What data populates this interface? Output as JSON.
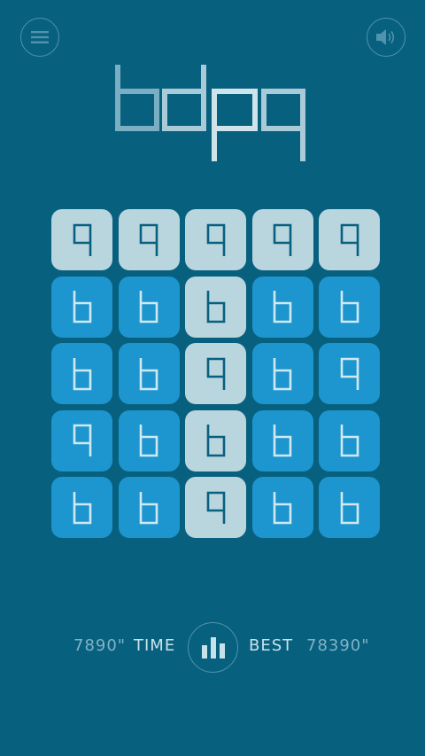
{
  "logo_text": "bdpq",
  "icons": {
    "menu": "menu-icon",
    "sound": "speaker-icon",
    "stats": "bar-chart-icon"
  },
  "colors": {
    "background": "#08607f",
    "tile_light": "#b9d6df",
    "tile_dark": "#1d95ce",
    "glyph_on_light": "#08607f",
    "glyph_on_dark": "#cfe9f2"
  },
  "board": {
    "rows": 5,
    "cols": 5,
    "tiles": [
      [
        {
          "glyph": "q",
          "shade": "light"
        },
        {
          "glyph": "q",
          "shade": "light"
        },
        {
          "glyph": "q",
          "shade": "light"
        },
        {
          "glyph": "q",
          "shade": "light"
        },
        {
          "glyph": "q",
          "shade": "light"
        }
      ],
      [
        {
          "glyph": "b",
          "shade": "dark"
        },
        {
          "glyph": "b",
          "shade": "dark"
        },
        {
          "glyph": "b",
          "shade": "light"
        },
        {
          "glyph": "b",
          "shade": "dark"
        },
        {
          "glyph": "b",
          "shade": "dark"
        }
      ],
      [
        {
          "glyph": "b",
          "shade": "dark"
        },
        {
          "glyph": "b",
          "shade": "dark"
        },
        {
          "glyph": "q",
          "shade": "light"
        },
        {
          "glyph": "b",
          "shade": "dark"
        },
        {
          "glyph": "q",
          "shade": "dark"
        }
      ],
      [
        {
          "glyph": "q",
          "shade": "dark"
        },
        {
          "glyph": "b",
          "shade": "dark"
        },
        {
          "glyph": "b",
          "shade": "light"
        },
        {
          "glyph": "b",
          "shade": "dark"
        },
        {
          "glyph": "b",
          "shade": "dark"
        }
      ],
      [
        {
          "glyph": "b",
          "shade": "dark"
        },
        {
          "glyph": "b",
          "shade": "dark"
        },
        {
          "glyph": "q",
          "shade": "light"
        },
        {
          "glyph": "b",
          "shade": "dark"
        },
        {
          "glyph": "b",
          "shade": "dark"
        }
      ]
    ]
  },
  "footer": {
    "time_value": "7890\"",
    "time_label": "TIME",
    "best_label": "BEST",
    "best_value": "78390\""
  }
}
